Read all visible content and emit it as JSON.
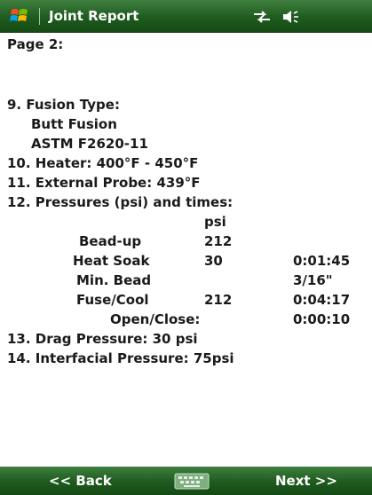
{
  "titlebar": {
    "title": "Joint Report",
    "logo_icon": "windows-flag-icon",
    "connectivity_icon": "connectivity-arrows-icon",
    "volume_icon": "speaker-volume-icon"
  },
  "report": {
    "page_label": "Page 2:",
    "fusion_type_label": "9. Fusion Type:",
    "fusion_type_value": "Butt Fusion",
    "fusion_standard": "ASTM F2620-11",
    "heater_line": "10. Heater: 400°F - 450°F",
    "probe_line": "11. External Probe: 439°F",
    "pressures_heading": "12. Pressures (psi) and times:",
    "psi_header": "psi",
    "rows": [
      {
        "label": "Bead-up",
        "psi": "212",
        "time": ""
      },
      {
        "label": "Heat Soak",
        "psi": "30",
        "time": "0:01:45"
      },
      {
        "label": "Min. Bead",
        "psi": "",
        "time": "3/16\""
      },
      {
        "label": "Fuse/Cool",
        "psi": "212",
        "time": "0:04:17"
      },
      {
        "label": "Open/Close:",
        "psi": "",
        "time": "0:00:10"
      }
    ],
    "drag_line": "13. Drag Pressure: 30 psi",
    "interfacial_line": "14. Interfacial Pressure: 75psi"
  },
  "softkeys": {
    "back_label": "<< Back",
    "next_label": "Next >>",
    "keyboard_icon": "keyboard-icon"
  },
  "colors": {
    "bar_green": "#1e5a1e",
    "text": "#1a1a1a",
    "bar_text": "#ffffff"
  }
}
